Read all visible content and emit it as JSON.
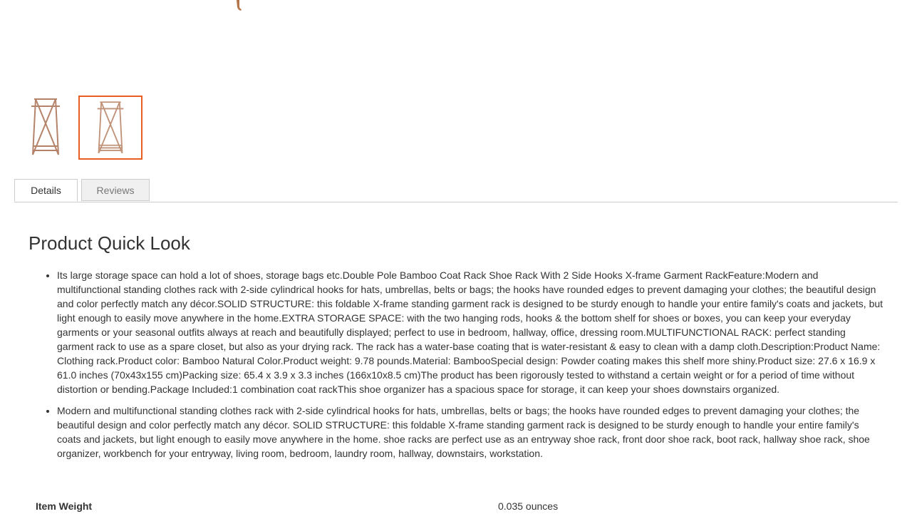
{
  "gallery": {
    "thumbnail_count": 2,
    "active_index": 1,
    "active_border_color": "#e85d22"
  },
  "tabs": [
    {
      "label": "Details",
      "active": true
    },
    {
      "label": "Reviews",
      "active": false
    }
  ],
  "details": {
    "title": "Product Quick Look",
    "bullets": [
      "Its large storage space can hold a lot of shoes, storage bags etc.Double Pole Bamboo Coat Rack Shoe Rack With 2 Side Hooks X-frame Garment RackFeature:Modern and multifunctional standing clothes rack with 2-side cylindrical hooks for hats, umbrellas, belts or bags; the hooks have rounded edges to prevent damaging your clothes; the beautiful design and color perfectly match any décor.SOLID STRUCTURE: this foldable X-frame standing garment rack is designed to be sturdy enough to handle your entire family's coats and jackets, but light enough to easily move anywhere in the home.EXTRA STORAGE SPACE: with the two hanging rods, hooks & the bottom shelf for shoes or boxes, you can keep your everyday garments or your seasonal outfits always at reach and beautifully displayed; perfect to use in bedroom, hallway, office, dressing room.MULTIFUNCTIONAL RACK: perfect standing garment rack to use as a spare closet, but also as your drying rack. The rack has a water-base coating that is water-resistant & easy to clean with a damp cloth.Description:Product Name: Clothing rack.Product color: Bamboo Natural Color.Product weight: 9.78 pounds.Material: BambooSpecial design: Powder coating makes this shelf more shiny.Product size: 27.6 x 16.9 x 61.0 inches (70x43x155 cm)Packing size: 65.4 x 3.9 x 3.3 inches (166x10x8.5 cm)The product has been rigorously tested to withstand a certain weight or for a period of time without distortion or bending.Package Included:1 combination coat rackThis shoe organizer has a spacious space for storage, it can keep your shoes downstairs organized.",
      "Modern and multifunctional standing clothes rack with 2-side cylindrical hooks for hats, umbrellas, belts or bags; the hooks have rounded edges to prevent damaging your clothes; the beautiful design and color perfectly match any décor. SOLID STRUCTURE: this foldable X-frame standing garment rack is designed to be sturdy enough to handle your entire family's coats and jackets, but light enough to easily move anywhere in the home. shoe racks are perfect use as an entryway shoe rack, front door shoe rack, boot rack, hallway shoe rack, shoe organizer, workbench for your entryway, living room, bedroom, laundry room, hallway, downstairs, workstation."
    ]
  },
  "specs": [
    {
      "label": "Item Weight",
      "value": "0.035 ounces"
    }
  ]
}
